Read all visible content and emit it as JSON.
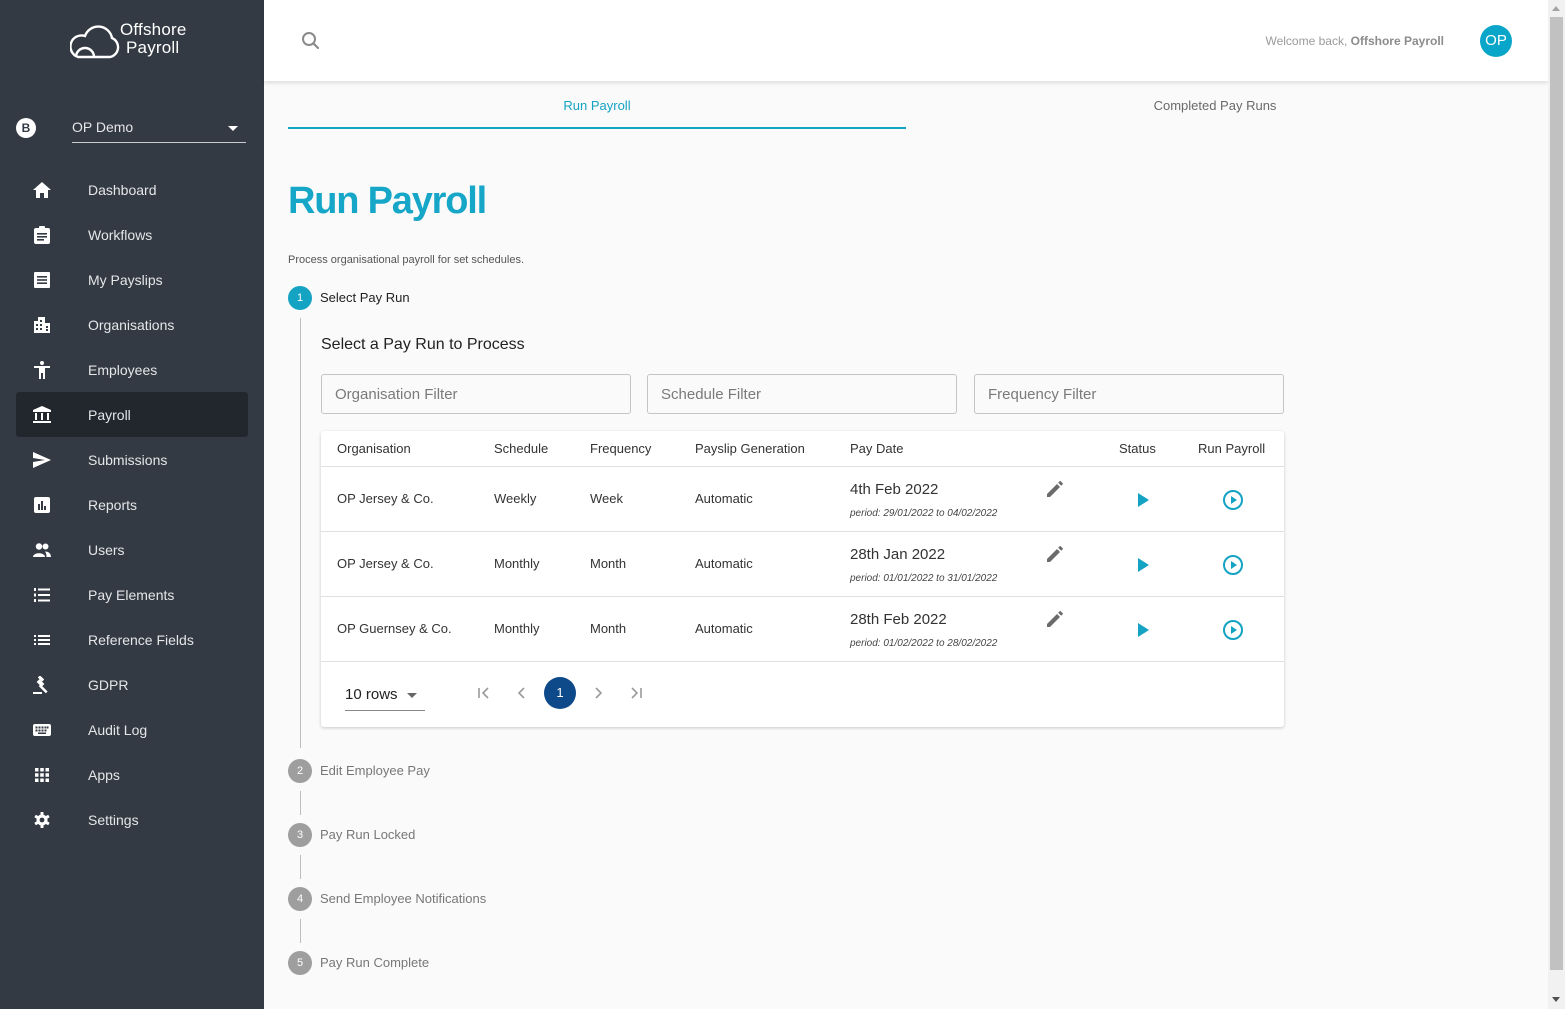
{
  "brand": {
    "line1": "Offshore",
    "line2": "Payroll"
  },
  "org_switcher": {
    "badge": "B",
    "selected": "OP Demo"
  },
  "sidebar": {
    "items": [
      {
        "label": "Dashboard",
        "icon": "home-icon"
      },
      {
        "label": "Workflows",
        "icon": "clipboard-icon"
      },
      {
        "label": "My Payslips",
        "icon": "receipt-icon"
      },
      {
        "label": "Organisations",
        "icon": "building-icon"
      },
      {
        "label": "Employees",
        "icon": "person-icon"
      },
      {
        "label": "Payroll",
        "icon": "bank-icon",
        "active": true
      },
      {
        "label": "Submissions",
        "icon": "send-icon"
      },
      {
        "label": "Reports",
        "icon": "chart-icon"
      },
      {
        "label": "Users",
        "icon": "users-icon"
      },
      {
        "label": "Pay Elements",
        "icon": "numbered-list-icon"
      },
      {
        "label": "Reference Fields",
        "icon": "list-icon"
      },
      {
        "label": "GDPR",
        "icon": "gavel-icon"
      },
      {
        "label": "Audit Log",
        "icon": "keyboard-icon"
      },
      {
        "label": "Apps",
        "icon": "apps-grid-icon"
      },
      {
        "label": "Settings",
        "icon": "gear-icon"
      }
    ]
  },
  "header": {
    "welcome_prefix": "Welcome back, ",
    "welcome_name": "Offshore Payroll",
    "avatar_initials": "OP"
  },
  "tabs": [
    {
      "label": "Run Payroll",
      "active": true
    },
    {
      "label": "Completed Pay Runs",
      "active": false
    }
  ],
  "page": {
    "title": "Run Payroll",
    "description": "Process organisational payroll for set schedules."
  },
  "steps": [
    {
      "num": "1",
      "label": "Select Pay Run",
      "active": true
    },
    {
      "num": "2",
      "label": "Edit Employee Pay"
    },
    {
      "num": "3",
      "label": "Pay Run Locked"
    },
    {
      "num": "4",
      "label": "Send Employee Notifications"
    },
    {
      "num": "5",
      "label": "Pay Run Complete"
    }
  ],
  "select_section": {
    "title": "Select a Pay Run to Process",
    "filters": {
      "organisation": {
        "placeholder": "Organisation Filter",
        "value": ""
      },
      "schedule": {
        "placeholder": "Schedule Filter",
        "value": ""
      },
      "frequency": {
        "placeholder": "Frequency Filter",
        "value": ""
      }
    }
  },
  "table": {
    "columns": [
      "Organisation",
      "Schedule",
      "Frequency",
      "Payslip Generation",
      "Pay Date",
      "Status",
      "Run Payroll"
    ],
    "rows": [
      {
        "organisation": "OP Jersey & Co.",
        "schedule": "Weekly",
        "frequency": "Week",
        "payslip_generation": "Automatic",
        "pay_date": "4th Feb 2022",
        "period": "period: 29/01/2022 to 04/02/2022"
      },
      {
        "organisation": "OP Jersey & Co.",
        "schedule": "Monthly",
        "frequency": "Month",
        "payslip_generation": "Automatic",
        "pay_date": "28th Jan 2022",
        "period": "period: 01/01/2022 to 31/01/2022"
      },
      {
        "organisation": "OP Guernsey & Co.",
        "schedule": "Monthly",
        "frequency": "Month",
        "payslip_generation": "Automatic",
        "pay_date": "28th Feb 2022",
        "period": "period: 01/02/2022 to 28/02/2022"
      }
    ],
    "pagination": {
      "rows_per_page": "10 rows",
      "current_page": "1"
    }
  },
  "colors": {
    "accent": "#14a3c2",
    "sidebar_bg": "#333a43",
    "sidebar_active": "#22272e",
    "page_current": "#0e4a8a",
    "step_inactive": "#9e9e9e"
  }
}
